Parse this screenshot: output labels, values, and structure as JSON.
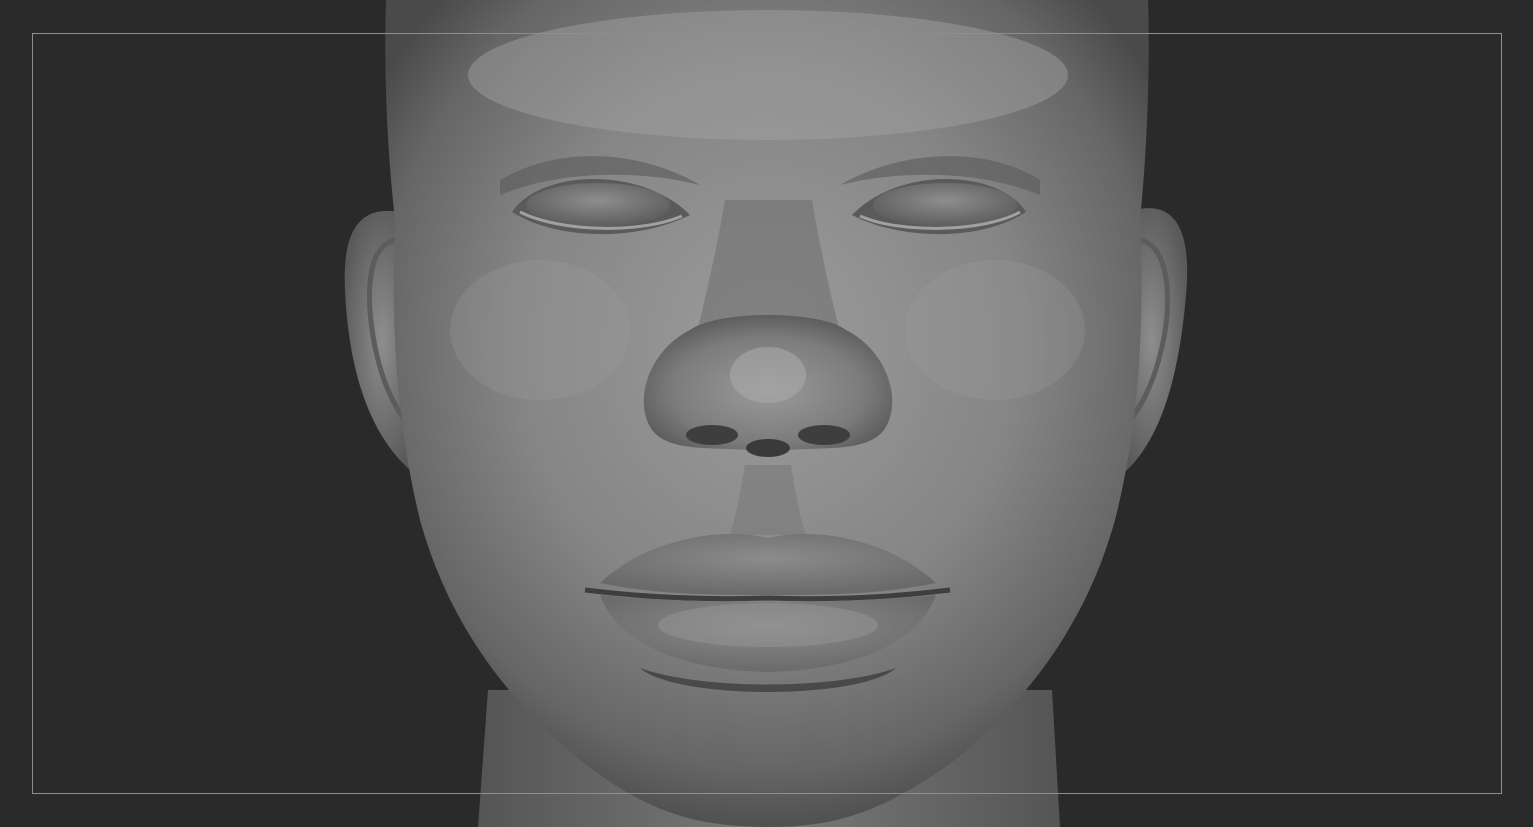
{
  "viewport": {
    "background": "#2a2a2a",
    "frame_color": "#8e8e8e",
    "model_color": "#8a8a8a"
  },
  "model": {
    "subject": "head-sculpt"
  }
}
